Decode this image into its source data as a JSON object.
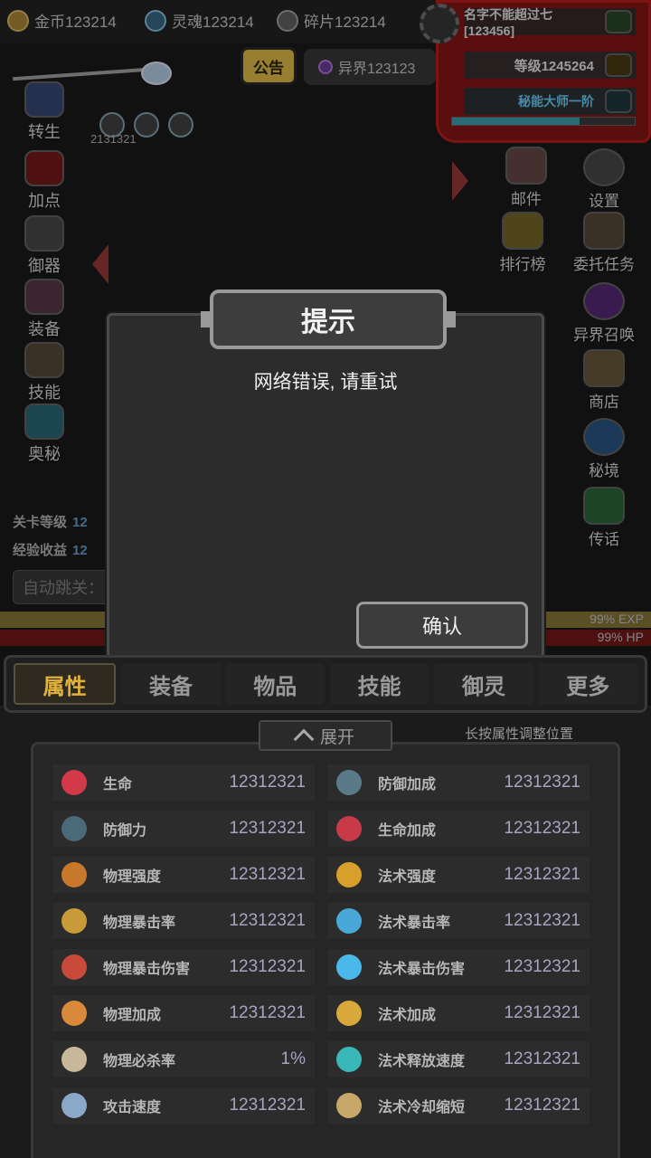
{
  "resources": [
    {
      "label": "金币123214",
      "icon": "gold-coin-icon"
    },
    {
      "label": "灵魂123214",
      "icon": "soul-icon"
    },
    {
      "label": "碎片123214",
      "icon": "fragment-icon"
    }
  ],
  "profile": {
    "name": "名字不能超过七[123456]",
    "level": "等级1245264",
    "title": "秘能大师一阶",
    "progress": 0.7
  },
  "notice": {
    "label": "公告"
  },
  "otherworld": {
    "label": "异界123123"
  },
  "buff_count": "2131321",
  "left_menu": [
    {
      "label": "转生",
      "icon": "rebirth-icon"
    },
    {
      "label": "加点",
      "icon": "add-points-icon"
    },
    {
      "label": "御器",
      "icon": "weapon-control-icon"
    },
    {
      "label": "装备",
      "icon": "equipment-icon"
    },
    {
      "label": "技能",
      "icon": "skill-scroll-icon"
    },
    {
      "label": "奥秘",
      "icon": "arcane-icon"
    }
  ],
  "right_menu": [
    {
      "label": "邮件",
      "icon": "mail-icon"
    },
    {
      "label": "设置",
      "icon": "gear-icon"
    },
    {
      "label": "排行榜",
      "icon": "trophy-icon"
    },
    {
      "label": "委托任务",
      "icon": "quest-icon"
    },
    {
      "label": "异界召唤",
      "icon": "summon-portal-icon"
    },
    {
      "label": "商店",
      "icon": "shop-icon"
    },
    {
      "label": "秘境",
      "icon": "realm-icon"
    },
    {
      "label": "传话",
      "icon": "horn-icon"
    }
  ],
  "stage": {
    "level_label": "关卡等级",
    "level_value": "12",
    "exp_label": "经验收益",
    "exp_value": "12",
    "auto_jump": "自动跳关："
  },
  "bars": {
    "exp": "99% EXP",
    "hp": "99% HP"
  },
  "dialog": {
    "title": "提示",
    "message": "网络错误, 请重试",
    "confirm": "确认"
  },
  "tabs": [
    "属性",
    "装备",
    "物品",
    "技能",
    "御灵",
    "更多"
  ],
  "expand": {
    "label": "展开"
  },
  "hint": "长按属性调整位置",
  "attributes": [
    [
      {
        "name": "生命",
        "value": "12312321",
        "icon": "heart-icon",
        "color": "#d23a4a"
      },
      {
        "name": "防御加成",
        "value": "12312321",
        "icon": "shield-plus-icon",
        "color": "#5a7a8a"
      }
    ],
    [
      {
        "name": "防御力",
        "value": "12312321",
        "icon": "shield-icon",
        "color": "#4a6a78"
      },
      {
        "name": "生命加成",
        "value": "12312321",
        "icon": "heart-plus-icon",
        "color": "#c83a4a"
      }
    ],
    [
      {
        "name": "物理强度",
        "value": "12312321",
        "icon": "sword-power-icon",
        "color": "#c8782a"
      },
      {
        "name": "法术强度",
        "value": "12312321",
        "icon": "magic-power-icon",
        "color": "#d8a02a"
      }
    ],
    [
      {
        "name": "物理暴击率",
        "value": "12312321",
        "icon": "phys-crit-icon",
        "color": "#c89a3a"
      },
      {
        "name": "法术暴击率",
        "value": "12312321",
        "icon": "magic-crit-icon",
        "color": "#4aa8d8"
      }
    ],
    [
      {
        "name": "物理暴击伤害",
        "value": "12312321",
        "icon": "phys-crit-damage-icon",
        "color": "#c84a3a"
      },
      {
        "name": "法术暴击伤害",
        "value": "12312321",
        "icon": "magic-crit-damage-icon",
        "color": "#4ab8e8"
      }
    ],
    [
      {
        "name": "物理加成",
        "value": "12312321",
        "icon": "phys-bonus-icon",
        "color": "#d88a3a"
      },
      {
        "name": "法术加成",
        "value": "12312321",
        "icon": "magic-bonus-icon",
        "color": "#d8a83a"
      }
    ],
    [
      {
        "name": "物理必杀率",
        "value": "1%",
        "icon": "skull-icon",
        "color": "#c8b89a"
      },
      {
        "name": "法术释放速度",
        "value": "12312321",
        "icon": "cast-speed-icon",
        "color": "#3ab8b8"
      }
    ],
    [
      {
        "name": "攻击速度",
        "value": "12312321",
        "icon": "attack-speed-icon",
        "color": "#8aa8c8"
      },
      {
        "name": "法术冷却缩短",
        "value": "12312321",
        "icon": "hourglass-icon",
        "color": "#c8a86a"
      }
    ]
  ]
}
